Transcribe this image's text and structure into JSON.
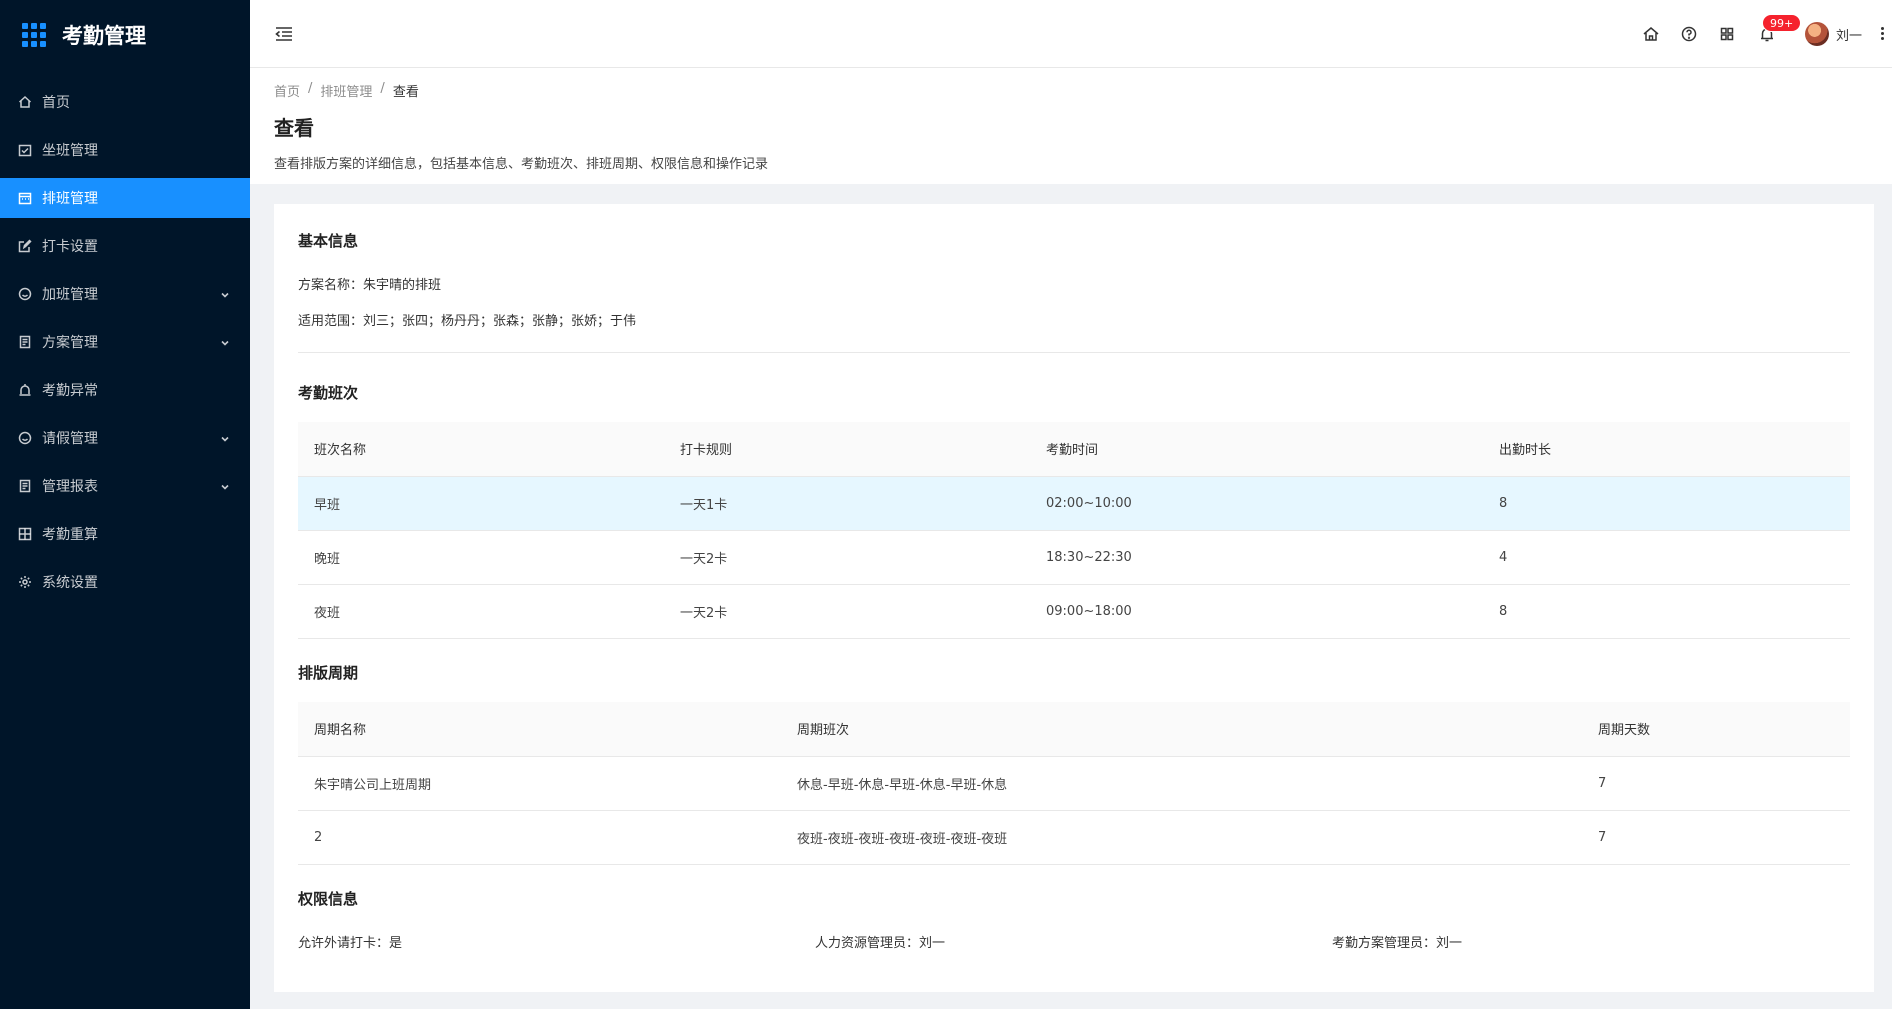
{
  "app": {
    "title": "考勤管理"
  },
  "sidebar": {
    "items": [
      {
        "label": "首页",
        "icon": "home-icon",
        "active": false,
        "expandable": false
      },
      {
        "label": "坐班管理",
        "icon": "calendar-check-icon",
        "active": false,
        "expandable": false
      },
      {
        "label": "排班管理",
        "icon": "calendar-icon",
        "active": true,
        "expandable": false
      },
      {
        "label": "打卡设置",
        "icon": "edit-icon",
        "active": false,
        "expandable": false
      },
      {
        "label": "加班管理",
        "icon": "smile-icon",
        "active": false,
        "expandable": true
      },
      {
        "label": "方案管理",
        "icon": "document-icon",
        "active": false,
        "expandable": true
      },
      {
        "label": "考勤异常",
        "icon": "alarm-icon",
        "active": false,
        "expandable": false
      },
      {
        "label": "请假管理",
        "icon": "smile-icon",
        "active": false,
        "expandable": true
      },
      {
        "label": "管理报表",
        "icon": "document-icon",
        "active": false,
        "expandable": true
      },
      {
        "label": "考勤重算",
        "icon": "calculator-icon",
        "active": false,
        "expandable": false
      },
      {
        "label": "系统设置",
        "icon": "gear-icon",
        "active": false,
        "expandable": false
      }
    ]
  },
  "header": {
    "notification_count": "99+",
    "user_name": "刘一",
    "icons": [
      "home-icon",
      "help-icon",
      "apps-icon",
      "bell-icon"
    ]
  },
  "page": {
    "breadcrumb": [
      "首页",
      "排班管理",
      "查看"
    ],
    "title": "查看",
    "description": "查看排版方案的详细信息，包括基本信息、考勤班次、排班周期、权限信息和操作记录"
  },
  "basic_info": {
    "title": "基本信息",
    "plan_name": "方案名称：朱宇晴的排班",
    "scope": "适用范围：刘三；张四；杨丹丹；张森；张静；张娇；于伟"
  },
  "shifts": {
    "title": "考勤班次",
    "columns": [
      "班次名称",
      "打卡规则",
      "考勤时间",
      "出勤时长"
    ],
    "rows": [
      [
        "早班",
        "一天1卡",
        "02:00~10:00",
        "8"
      ],
      [
        "晚班",
        "一天2卡",
        "18:30~22:30",
        "4"
      ],
      [
        "夜班",
        "一天2卡",
        "09:00~18:00",
        "8"
      ]
    ]
  },
  "cycles": {
    "title": "排版周期",
    "columns": [
      "周期名称",
      "周期班次",
      "周期天数"
    ],
    "rows": [
      [
        "朱宇晴公司上班周期",
        "休息-早班-休息-早班-休息-早班-休息",
        "7"
      ],
      [
        "2",
        "夜班-夜班-夜班-夜班-夜班-夜班-夜班",
        "7"
      ]
    ]
  },
  "permissions": {
    "title": "权限信息",
    "allow_outside": "允许外请打卡：是",
    "hr_admin": "人力资源管理员：刘一",
    "plan_admin": "考勤方案管理员：刘一"
  },
  "colors": {
    "primary": "#1890ff",
    "sidebar_bg": "#001529",
    "badge": "#f5222d",
    "row_highlight": "#e6f7ff"
  }
}
